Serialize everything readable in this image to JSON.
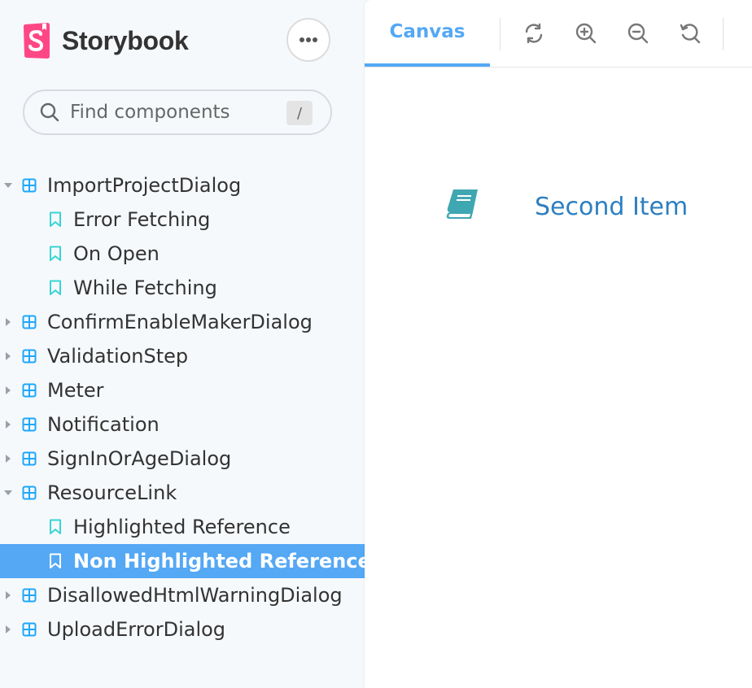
{
  "app": {
    "name": "Storybook",
    "brand_color": "#ff4785",
    "accent_color": "#54a8f4"
  },
  "header": {
    "menu_icon": "ellipsis-icon"
  },
  "search": {
    "placeholder": "Find components",
    "shortcut": "/"
  },
  "tree": [
    {
      "type": "component",
      "label": "ImportProjectDialog",
      "expanded": true
    },
    {
      "type": "story",
      "label": "Error Fetching"
    },
    {
      "type": "story",
      "label": "On Open"
    },
    {
      "type": "story",
      "label": "While Fetching"
    },
    {
      "type": "component",
      "label": "ConfirmEnableMakerDialog",
      "expanded": false
    },
    {
      "type": "component",
      "label": "ValidationStep",
      "expanded": false
    },
    {
      "type": "component",
      "label": "Meter",
      "expanded": false
    },
    {
      "type": "component",
      "label": "Notification",
      "expanded": false
    },
    {
      "type": "component",
      "label": "SignInOrAgeDialog",
      "expanded": false
    },
    {
      "type": "component",
      "label": "ResourceLink",
      "expanded": true
    },
    {
      "type": "story",
      "label": "Highlighted Reference"
    },
    {
      "type": "story",
      "label": "Non Highlighted Reference",
      "selected": true
    },
    {
      "type": "component",
      "label": "DisallowedHtmlWarningDialog",
      "expanded": false
    },
    {
      "type": "component",
      "label": "UploadErrorDialog",
      "expanded": false
    }
  ],
  "toolbar": {
    "tab_label": "Canvas",
    "tools": [
      "reload-icon",
      "zoom-in-icon",
      "zoom-out-icon",
      "zoom-reset-icon"
    ]
  },
  "preview": {
    "icon": "book-icon",
    "text": "Second Item",
    "text_color": "#2d7fc1",
    "icon_color": "#3fa7b1"
  }
}
